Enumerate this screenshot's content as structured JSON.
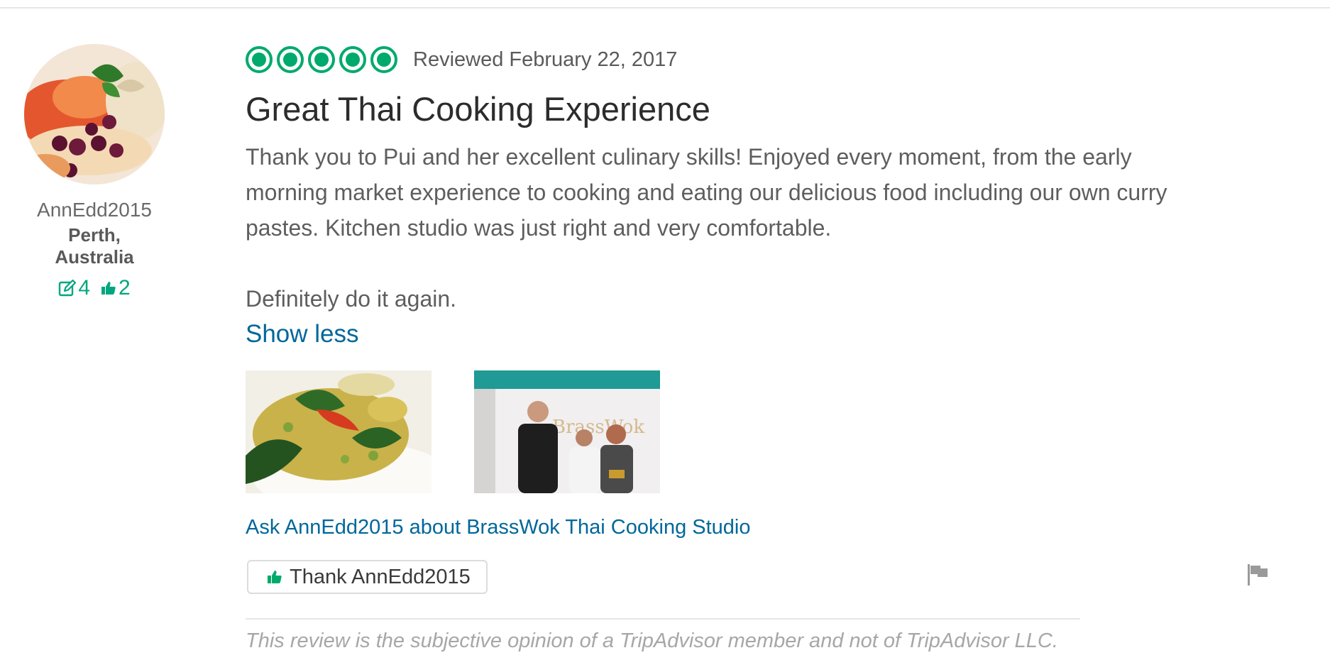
{
  "reviewer": {
    "username": "AnnEdd2015",
    "location": "Perth, Australia",
    "review_count": "4",
    "helpful_votes": "2"
  },
  "review": {
    "rating": 5,
    "date_text": "Reviewed February 22, 2017",
    "title": "Great Thai Cooking Experience",
    "body_paragraph_1": "Thank you to Pui and her excellent culinary skills! Enjoyed every moment, from the early morning market experience to cooking and eating our delicious food including our own curry pastes. Kitchen studio was just right and very comfortable.",
    "body_paragraph_2": "Definitely do it again.",
    "show_less_label": "Show less",
    "ask_link": "Ask AnnEdd2015 about BrassWok Thai Cooking Studio",
    "thank_button_label": "Thank AnnEdd2015",
    "disclaimer": "This review is the subjective opinion of a TripAdvisor member and not of TripAdvisor LLC."
  },
  "colors": {
    "brand_green": "#00aa6c",
    "link_blue": "#00679a"
  },
  "icons": [
    "edit-icon",
    "thumbs-up-icon",
    "flag-icon"
  ]
}
